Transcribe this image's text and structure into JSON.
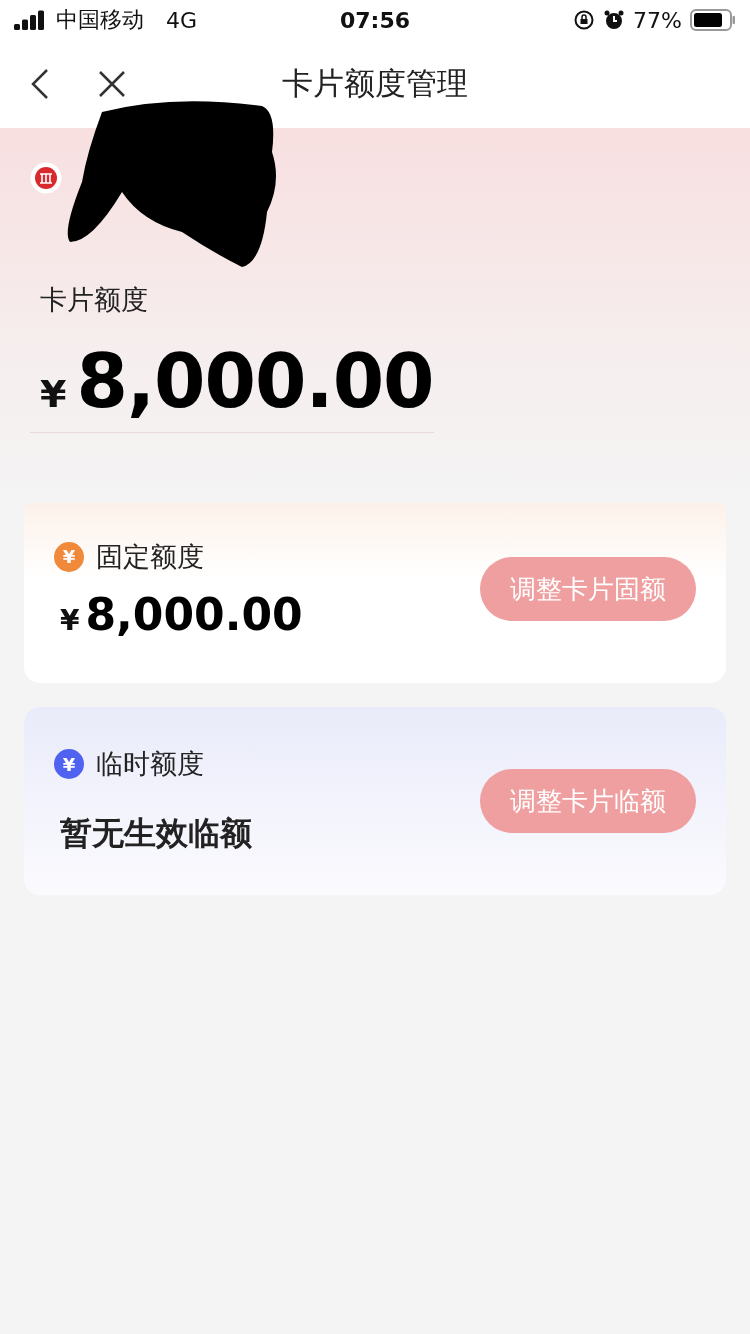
{
  "status_bar": {
    "carrier": "中国移动",
    "network": "4G",
    "time": "07:56",
    "battery": "77%"
  },
  "nav": {
    "title": "卡片额度管理"
  },
  "card_limit": {
    "label": "卡片额度",
    "currency": "¥",
    "amount": "8,000.00"
  },
  "quotas": [
    {
      "kind": "amount",
      "color": "#f08a3a",
      "icon": "¥",
      "title": "固定额度",
      "currency": "¥",
      "value": "8,000.00",
      "button": "调整卡片固额"
    },
    {
      "kind": "text",
      "color": "#4f63f0",
      "icon": "¥",
      "title": "临时额度",
      "value": "暂无生效临额",
      "button": "调整卡片临额"
    }
  ]
}
